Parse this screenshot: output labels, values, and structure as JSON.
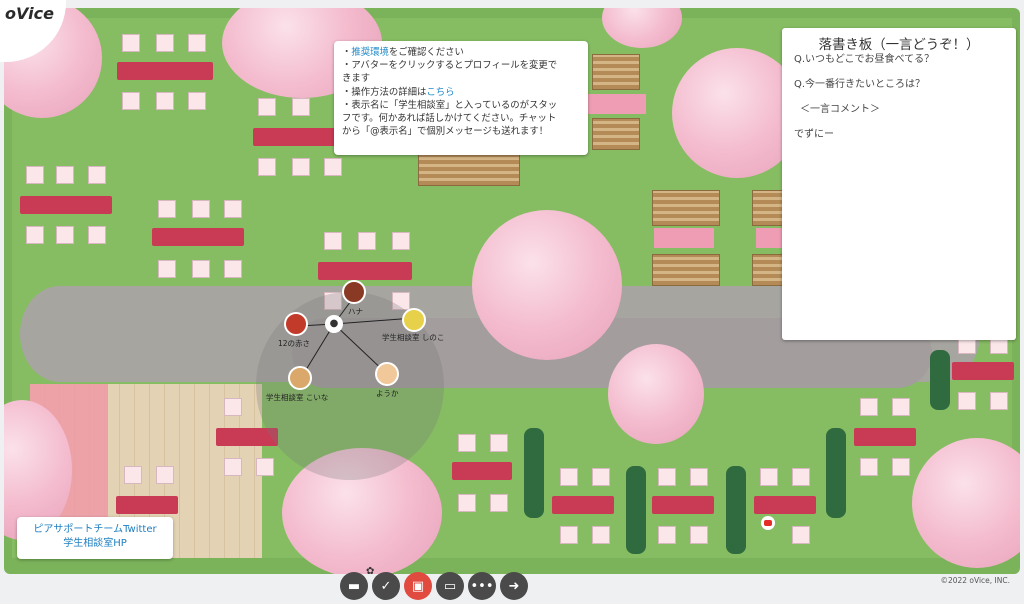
{
  "app": {
    "logo": "oVice",
    "copyright": "©2022 oVice, INC."
  },
  "info_panel": {
    "lines": [
      {
        "pre": "・",
        "link": "推奨環境",
        "post": "をご確認ください"
      },
      {
        "pre": "・アバターをクリックするとプロフィールを変更で",
        "link": "",
        "post": ""
      },
      {
        "pre": "きます",
        "link": "",
        "post": ""
      },
      {
        "pre": "・操作方法の詳細は",
        "link": "こちら",
        "post": ""
      },
      {
        "pre": "・表示名に「学生相談室」と入っているのがスタッ",
        "link": "",
        "post": ""
      },
      {
        "pre": "フです。何かあれば話しかけてください。チャット",
        "link": "",
        "post": ""
      },
      {
        "pre": "から「@表示名」で個別メッセージも送れます！",
        "link": "",
        "post": ""
      }
    ]
  },
  "board": {
    "title": "落書き板（一言どうぞ！）",
    "lines": [
      "Q.いつもどこでお昼食べてる？",
      "",
      "Q.今一番行きたいところは？",
      "",
      "＜一言コメント＞",
      "",
      "でずにー"
    ]
  },
  "links": {
    "twitter": "ピアサポートチームTwitter",
    "hp": "学生相談室HP"
  },
  "avatars": [
    {
      "label": "12の赤さ",
      "color": "#c23a2a"
    },
    {
      "label": "ハナ",
      "color": "#8a3a24"
    },
    {
      "label": "学生相談室 しのこ",
      "color": "#e8d14a"
    },
    {
      "label": "学生相談室 こいな",
      "color": "#d9a86a"
    },
    {
      "label": "ようか",
      "color": "#f0c89a"
    }
  ],
  "toolbar": [
    "chat-icon",
    "mic-icon",
    "camera-off-icon",
    "coffee-icon",
    "more-icon",
    "exit-icon"
  ]
}
